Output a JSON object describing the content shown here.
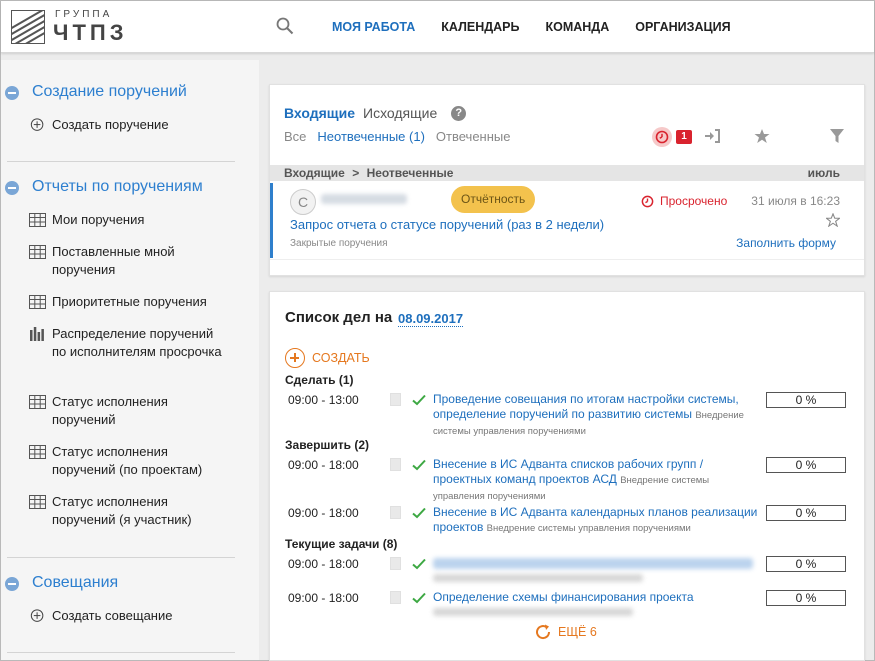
{
  "header": {
    "logo_top": "ГРУППА",
    "logo_bottom": "ЧТПЗ",
    "nav": [
      "МОЯ РАБОТА",
      "КАЛЕНДАРЬ",
      "КОМАНДА",
      "ОРГАНИЗАЦИЯ"
    ],
    "active_index": 0
  },
  "sidebar": {
    "sections": [
      {
        "title": "Создание поручений",
        "items": [
          {
            "icon": "plus-circle-icon",
            "label": "Создать поручение"
          }
        ]
      },
      {
        "title": "Отчеты по поручениям",
        "items": [
          {
            "icon": "table-icon",
            "label": "Мои поручения"
          },
          {
            "icon": "table-icon",
            "label": "Поставленные мной поручения"
          },
          {
            "icon": "table-icon",
            "label": "Приоритетные поручения"
          },
          {
            "icon": "bar-chart-icon",
            "label": "Распределение поручений по исполнителям просрочка"
          },
          {
            "icon": "table-icon",
            "label": "Статус исполнения поручений"
          },
          {
            "icon": "table-icon",
            "label": "Статус исполнения поручений (по проектам)"
          },
          {
            "icon": "table-icon",
            "label": "Статус исполнения поручений (я участник)"
          }
        ]
      },
      {
        "title": "Совещания",
        "items": [
          {
            "icon": "plus-circle-icon",
            "label": "Создать совещание"
          }
        ]
      }
    ]
  },
  "inbox": {
    "tab_incoming": "Входящие",
    "tab_outgoing": "Исходящие",
    "help": "?",
    "filter_all": "Все",
    "filter_unanswered": "Неотвеченные (1)",
    "filter_answered": "Отвеченные",
    "overdue_count": "1",
    "crumb_incoming": "Входящие",
    "crumb_sep": ">",
    "crumb_unanswered": "Неотвеченные",
    "crumb_month": "июль",
    "colors": {
      "accent": "#1e6fbd",
      "overdue": "#d9232e",
      "badge": "#f3c24d"
    },
    "message": {
      "avatar_letter": "С",
      "badge": "Отчётность",
      "status": "Просрочено",
      "date": "31 июля в 16:23",
      "subject": "Запрос отчета о статусе поручений (раз в 2 недели)",
      "folder": "Закрытые поручения",
      "action": "Заполнить форму"
    }
  },
  "todo": {
    "title": "Список дел на",
    "date": "08.09.2017",
    "create_label": "СОЗДАТЬ",
    "more_label": "ЕЩЁ 6",
    "groups": {
      "do": "Сделать (1)",
      "finish": "Завершить (2)",
      "current": "Текущие задачи (8)"
    },
    "tasks": [
      {
        "time": "09:00 - 13:00",
        "title": "Проведение совещания по итогам настройки системы, определение поручений по развитию системы",
        "project": "Внедрение системы управления поручениями",
        "progress": "0 %"
      },
      {
        "time": "09:00 - 18:00",
        "title": "Внесение в ИС Адванта списков рабочих групп / проектных команд проектов АСД",
        "project": "Внедрение системы управления поручениями",
        "progress": "0 %"
      },
      {
        "time": "09:00 - 18:00",
        "title": "Внесение в ИС Адванта календарных планов реализации проектов",
        "project": "Внедрение системы управления поручениями",
        "progress": "0 %"
      },
      {
        "time": "09:00 - 18:00",
        "progress": "0 %"
      },
      {
        "time": "09:00 - 18:00",
        "title": "Определение схемы финансирования проекта",
        "progress": "0 %"
      }
    ]
  }
}
